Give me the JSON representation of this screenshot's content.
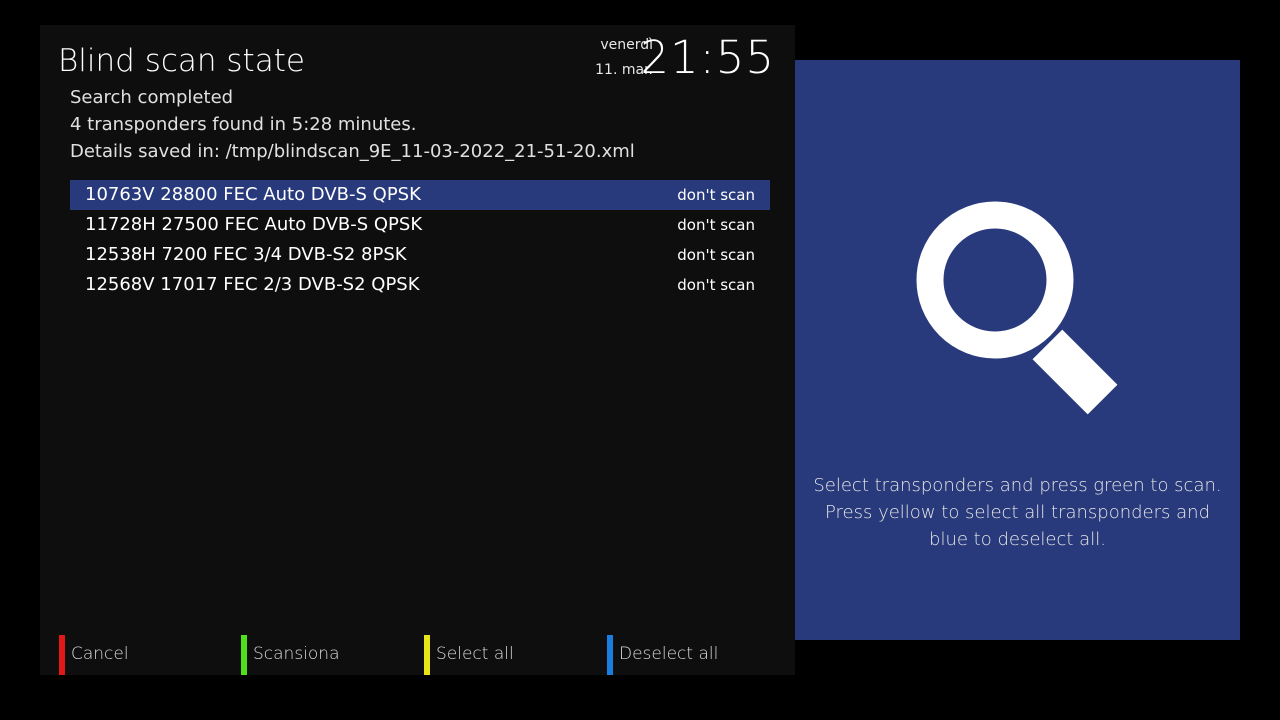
{
  "window": {
    "title": "Blind scan state"
  },
  "clock": {
    "day": "venerdì",
    "date": "11. mar.",
    "time": "21:55"
  },
  "info": {
    "status": "Search completed",
    "found": "4 transponders found in 5:28 minutes.",
    "details": "Details saved in: /tmp/blindscan_9E_11-03-2022_21-51-20.xml"
  },
  "transponders": [
    {
      "desc": "10763V 28800 FEC Auto DVB-S QPSK",
      "status": "don't scan",
      "selected": true
    },
    {
      "desc": "11728H 27500 FEC Auto DVB-S QPSK",
      "status": "don't scan",
      "selected": false
    },
    {
      "desc": "12538H 7200 FEC 3/4 DVB-S2 8PSK",
      "status": "don't scan",
      "selected": false
    },
    {
      "desc": "12568V 17017 FEC 2/3 DVB-S2 QPSK",
      "status": "don't scan",
      "selected": false
    }
  ],
  "keys": {
    "red": "Cancel",
    "green": "Scansiona",
    "yellow": "Select all",
    "blue": "Deselect all"
  },
  "help": {
    "icon": "search-icon",
    "text": "Select transponders and press green to scan. Press yellow to select all transponders and blue to deselect all."
  },
  "colors": {
    "panel_bg": "#0e0e0e",
    "selection": "#283a7b",
    "side_panel": "#283a7b",
    "key_red": "#e01818",
    "key_green": "#4ee01c",
    "key_yellow": "#e8e41a",
    "key_blue": "#1a7ee0"
  }
}
